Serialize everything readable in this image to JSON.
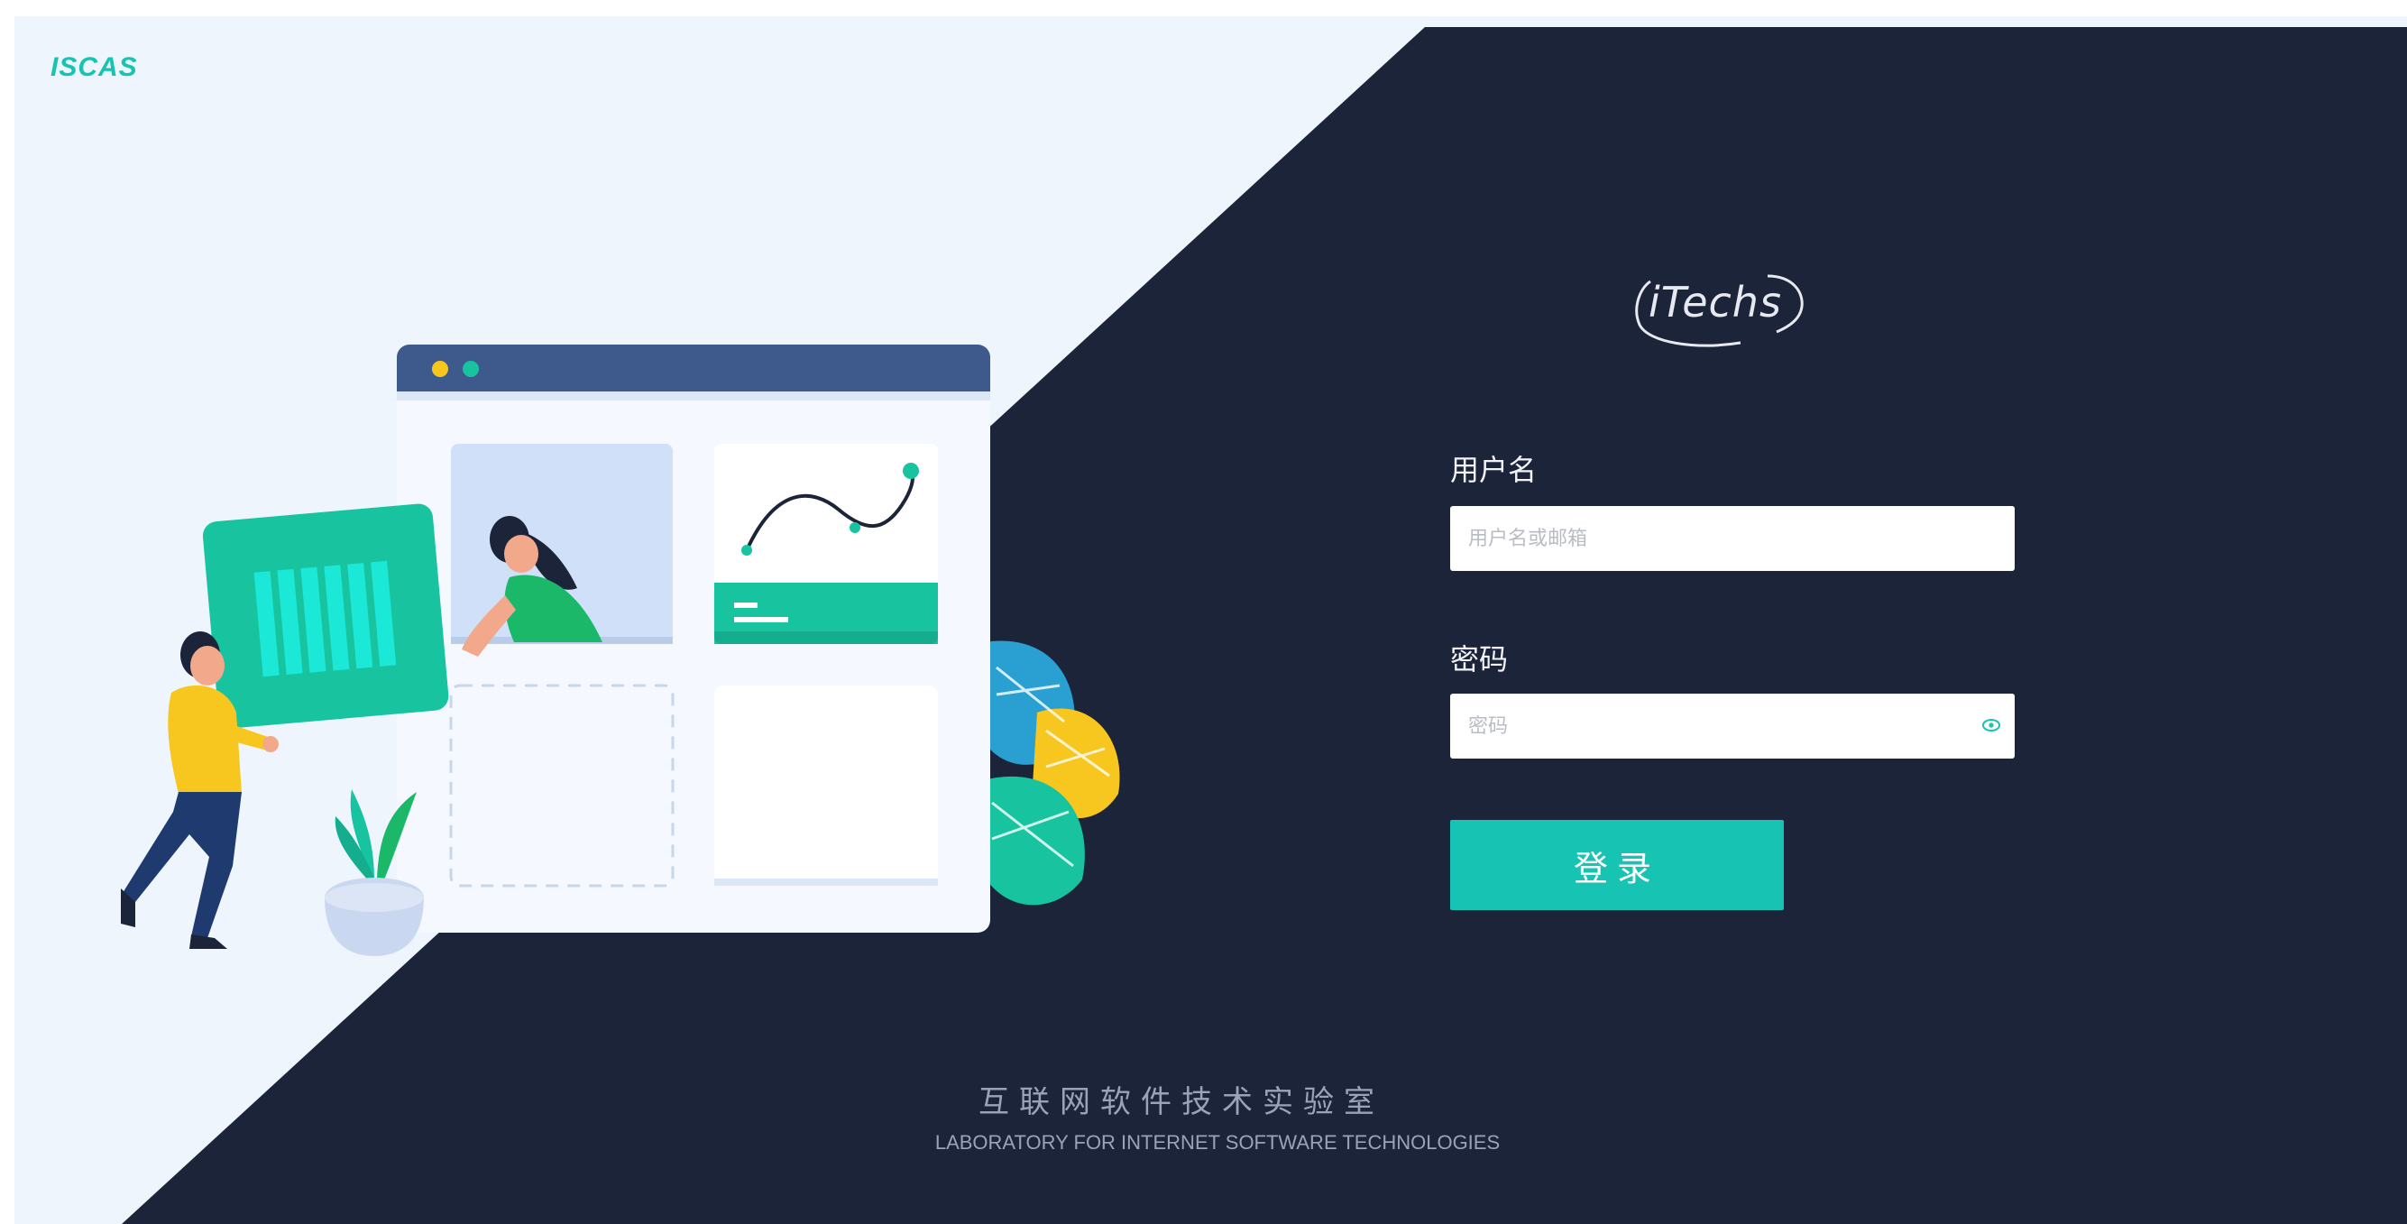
{
  "brand": {
    "name": "ISCAS"
  },
  "logo": {
    "text": "iTechs"
  },
  "login": {
    "username_label": "用户名",
    "username_placeholder": "用户名或邮箱",
    "password_label": "密码",
    "password_placeholder": "密码",
    "submit_label": "登录"
  },
  "footer": {
    "title_cn": "互联网软件技术实验室",
    "title_en": "LABORATORY FOR INTERNET SOFTWARE TECHNOLOGIES"
  },
  "colors": {
    "accent": "#17c3b2",
    "dark_panel": "#1c2439",
    "light_panel": "#eef5fd",
    "window_bar": "#3e5a8c"
  },
  "icons": [
    "eye-icon",
    "logo-swoosh"
  ]
}
